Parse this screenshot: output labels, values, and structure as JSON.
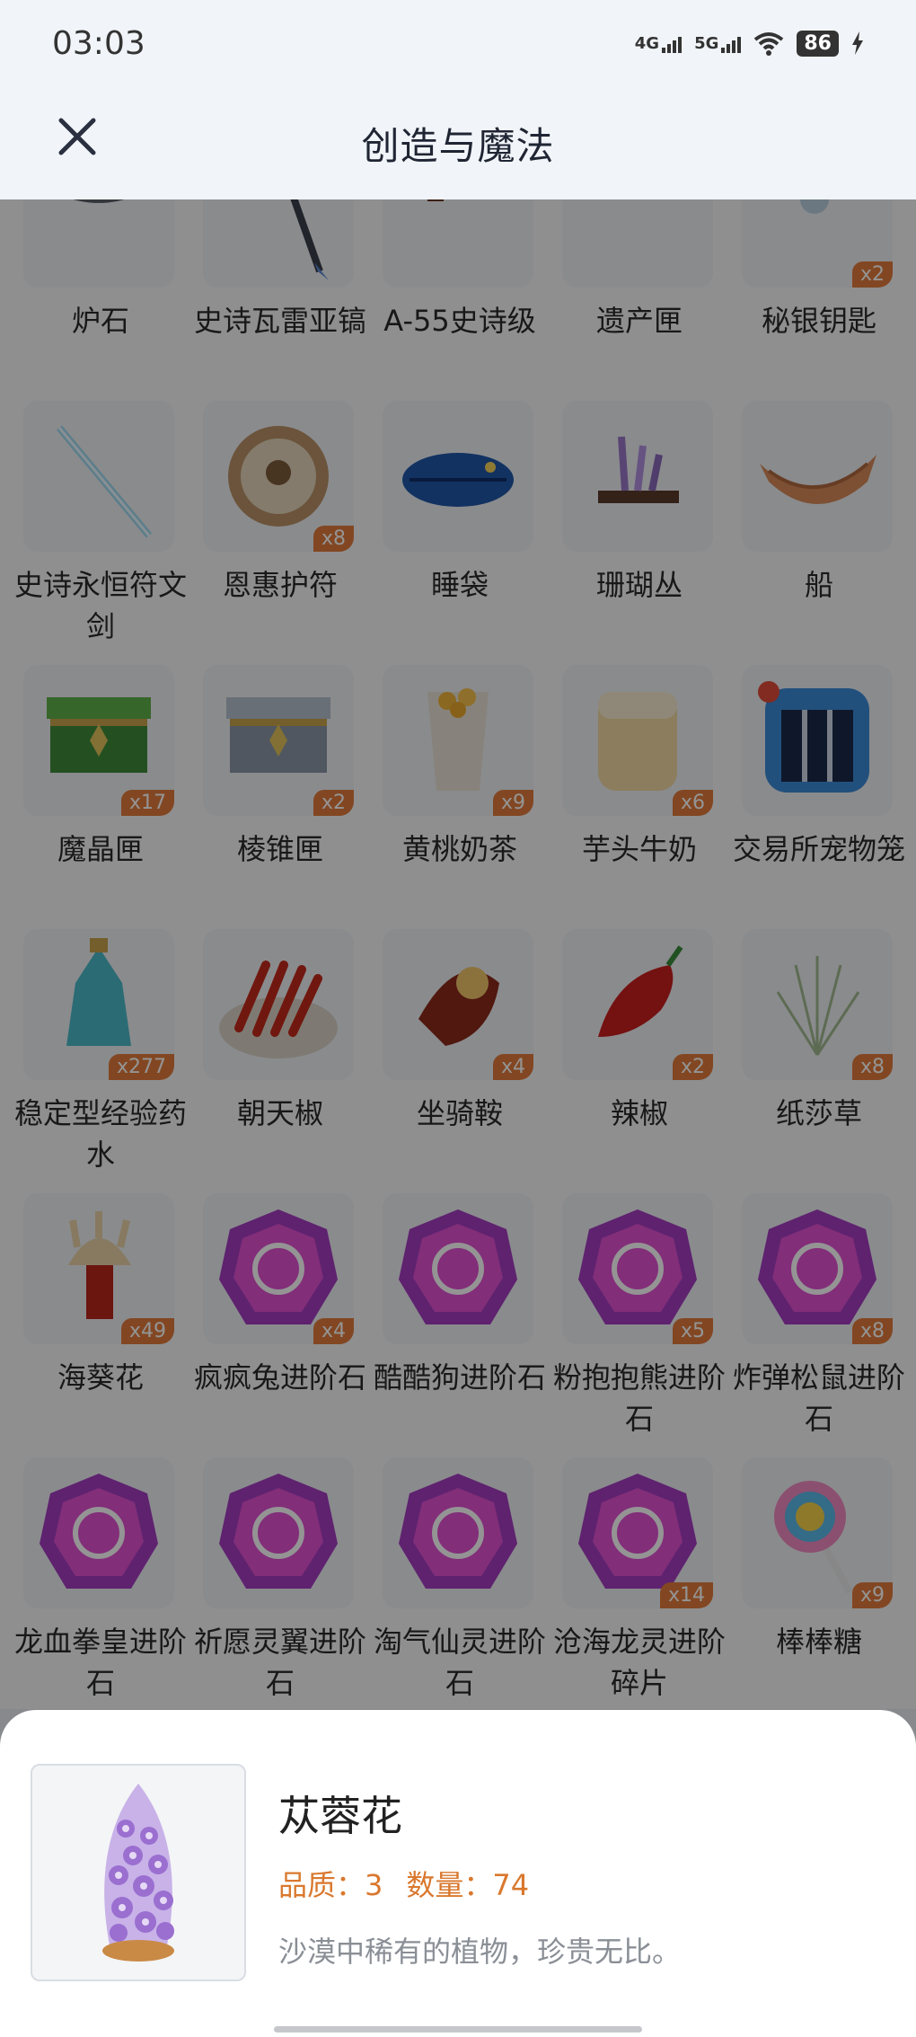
{
  "status_bar": {
    "time": "03:03",
    "network1": "4G",
    "network2": "5G",
    "battery": "86"
  },
  "header": {
    "title": "创造与魔法"
  },
  "items": [
    {
      "name": "炉石",
      "qty": "",
      "icon": "hearthstone-icon"
    },
    {
      "name": "史诗瓦雷亚镐",
      "qty": "",
      "icon": "pickaxe-icon"
    },
    {
      "name": "A-55史诗级",
      "qty": "",
      "icon": "rifle-icon"
    },
    {
      "name": "遗产匣",
      "qty": "",
      "icon": "legacy-box-icon"
    },
    {
      "name": "秘银钥匙",
      "qty": "x2",
      "icon": "mithril-key-icon"
    },
    {
      "name": "史诗永恒符文剑",
      "qty": "",
      "icon": "rune-sword-icon"
    },
    {
      "name": "恩惠护符",
      "qty": "x8",
      "icon": "amulet-icon"
    },
    {
      "name": "睡袋",
      "qty": "",
      "icon": "sleeping-bag-icon"
    },
    {
      "name": "珊瑚丛",
      "qty": "",
      "icon": "coral-icon"
    },
    {
      "name": "船",
      "qty": "",
      "icon": "boat-icon"
    },
    {
      "name": "魔晶匣",
      "qty": "x17",
      "icon": "crystal-box-icon"
    },
    {
      "name": "棱锥匣",
      "qty": "x2",
      "icon": "pyramid-box-icon"
    },
    {
      "name": "黄桃奶茶",
      "qty": "x9",
      "icon": "peach-milk-tea-icon"
    },
    {
      "name": "芋头牛奶",
      "qty": "x6",
      "icon": "taro-milk-icon"
    },
    {
      "name": "交易所宠物笼",
      "qty": "",
      "icon": "pet-cage-icon"
    },
    {
      "name": "稳定型经验药水",
      "qty": "x277",
      "icon": "exp-potion-icon"
    },
    {
      "name": "朝天椒",
      "qty": "",
      "icon": "chili-bowl-icon"
    },
    {
      "name": "坐骑鞍",
      "qty": "x4",
      "icon": "saddle-icon"
    },
    {
      "name": "辣椒",
      "qty": "x2",
      "icon": "pepper-icon"
    },
    {
      "name": "纸莎草",
      "qty": "x8",
      "icon": "papyrus-icon"
    },
    {
      "name": "海葵花",
      "qty": "x49",
      "icon": "anemone-icon"
    },
    {
      "name": "疯疯兔进阶石",
      "qty": "x4",
      "icon": "rabbit-stone-icon"
    },
    {
      "name": "酷酷狗进阶石",
      "qty": "",
      "icon": "dog-stone-icon"
    },
    {
      "name": "粉抱抱熊进阶石",
      "qty": "x5",
      "icon": "bear-stone-icon"
    },
    {
      "name": "炸弹松鼠进阶石",
      "qty": "x8",
      "icon": "squirrel-stone-icon"
    },
    {
      "name": "龙血拳皇进阶石",
      "qty": "",
      "icon": "bull-stone-icon"
    },
    {
      "name": "祈愿灵翼进阶石",
      "qty": "",
      "icon": "wing-stone-icon"
    },
    {
      "name": "淘气仙灵进阶石",
      "qty": "",
      "icon": "fairy-stone-icon"
    },
    {
      "name": "沧海龙灵进阶碎片",
      "qty": "x14",
      "icon": "dragon-shard-icon"
    },
    {
      "name": "棒棒糖",
      "qty": "x9",
      "icon": "lollipop-icon"
    }
  ],
  "detail": {
    "name": "苁蓉花",
    "quality_label": "品质：3",
    "quantity_label": "数量：74",
    "description": "沙漠中稀有的植物，珍贵无比。",
    "icon": "cistanche-flower-icon"
  },
  "colors": {
    "qty_badge": "#e07a3c",
    "stat_text": "#d9782e"
  }
}
